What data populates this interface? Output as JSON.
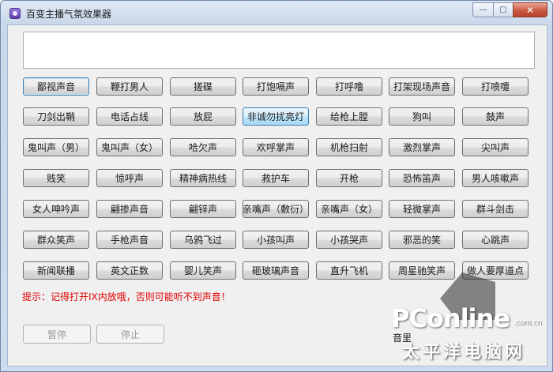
{
  "window": {
    "title": "百变主播气氛效果器",
    "caption": {
      "min": "—",
      "max": "□",
      "close": "✕"
    }
  },
  "sounds": [
    [
      "鄙视声音",
      "鞭打男人",
      "搓碟",
      "打饱嗝声",
      "打呼噜",
      "打架现场声音",
      "打喷嚏"
    ],
    [
      "刀剑出鞘",
      "电话占线",
      "放屁",
      "非诚勿扰亮灯",
      "给枪上膛",
      "狗叫",
      "鼓声"
    ],
    [
      "鬼叫声（男）",
      "鬼叫声（女）",
      "哈欠声",
      "欢呼掌声",
      "机枪扫射",
      "激烈掌声",
      "尖叫声"
    ],
    [
      "贱笑",
      "惊呼声",
      "精神病热线",
      "救护车",
      "开枪",
      "恐怖笛声",
      "男人咳嗽声"
    ],
    [
      "女人呻吟声",
      "翩掺声音",
      "翩锌声",
      "亲嘴声（敷衍）",
      "亲嘴声（女）",
      "轻微掌声",
      "群斗剑击"
    ],
    [
      "群众笑声",
      "手枪声音",
      "乌鸦飞过",
      "小孩叫声",
      "小孩哭声",
      "邪恶的笑",
      "心跳声"
    ],
    [
      "新闻联播",
      "英文正数",
      "婴儿笑声",
      "砸玻璃声音",
      "直升飞机",
      "周星驰笑声",
      "做人要厚道点"
    ]
  ],
  "tip": "提示：记得打开IX内放哦，否则可能听不到声音！",
  "controls": {
    "pause": "暂停",
    "stop": "停止",
    "volume": "音里"
  },
  "watermark": {
    "logo": "PConline",
    "domain": ".com.cn",
    "cn": "太平洋电脑网"
  }
}
